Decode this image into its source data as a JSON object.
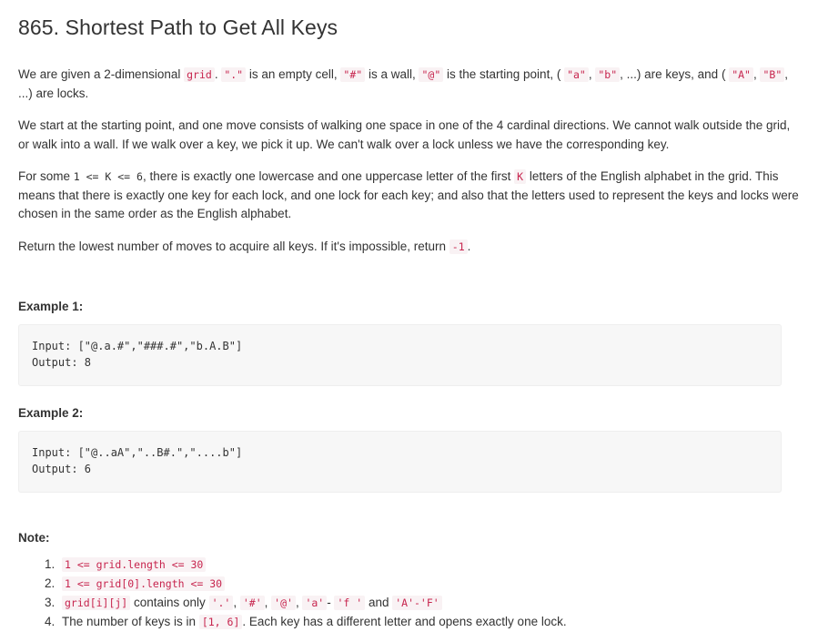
{
  "title": "865. Shortest Path to Get All Keys",
  "colors": {
    "code_text": "#c7254e",
    "code_bg": "#f9f2f4",
    "block_bg": "#f7f7f7",
    "block_border": "#eeeeee",
    "body_text": "#333333"
  },
  "paragraphs": {
    "p1": {
      "t1": "We are given a 2-dimensional ",
      "c1": "grid",
      "t2": ". ",
      "c2": "\".\"",
      "t3": " is an empty cell, ",
      "c3": "\"#\"",
      "t4": " is a wall, ",
      "c4": "\"@\"",
      "t5": " is the starting point, ( ",
      "c5": "\"a\"",
      "t6": ", ",
      "c6": "\"b\"",
      "t7": ", ...) are keys, and ( ",
      "c7": "\"A\"",
      "t8": ", ",
      "c8": "\"B\"",
      "t9": ", ...) are locks."
    },
    "p2": {
      "t1": "We start at the starting point, and one move consists of walking one space in one of the 4 cardinal directions.  We cannot walk outside the grid, or walk into a wall.  If we walk over a key, we pick it up.  We can't walk over a lock unless we have the corresponding key."
    },
    "p3": {
      "t1": "For some ",
      "c1": "1 <= K <= 6",
      "t2": ", there is exactly one lowercase and one uppercase letter of the first ",
      "c2": "K",
      "t3": " letters of the English alphabet in the grid. This means that there is exactly one key for each lock, and one lock for each key; and also that the letters used to represent the keys and locks were chosen in the same order as the English alphabet."
    },
    "p4": {
      "t1": "Return the lowest number of moves to acquire all keys.  If it's impossible, return ",
      "c1": "-1",
      "t2": "."
    }
  },
  "examples": [
    {
      "heading": "Example 1:",
      "code": "Input: [\"@.a.#\",\"###.#\",\"b.A.B\"]\nOutput: 8"
    },
    {
      "heading": "Example 2:",
      "code": "Input: [\"@..aA\",\"..B#.\",\"....b\"]\nOutput: 6"
    }
  ],
  "note": {
    "heading": "Note:",
    "items": [
      {
        "c1": "1 <= grid.length <= 30"
      },
      {
        "c1": "1 <= grid[0].length <= 30"
      },
      {
        "c1": "grid[i][j]",
        "t1": " contains only ",
        "c2": "'.'",
        "t2": ", ",
        "c3": "'#'",
        "t3": ", ",
        "c4": "'@'",
        "t4": ", ",
        "c5": "'a'",
        "t5": "- ",
        "c6": "'f '",
        "t6": " and ",
        "c7": "'A'-'F'"
      },
      {
        "t0": "The number of keys is in ",
        "c1": "[1, 6]",
        "t1": ".  Each key has a different letter and opens exactly one lock."
      }
    ]
  }
}
